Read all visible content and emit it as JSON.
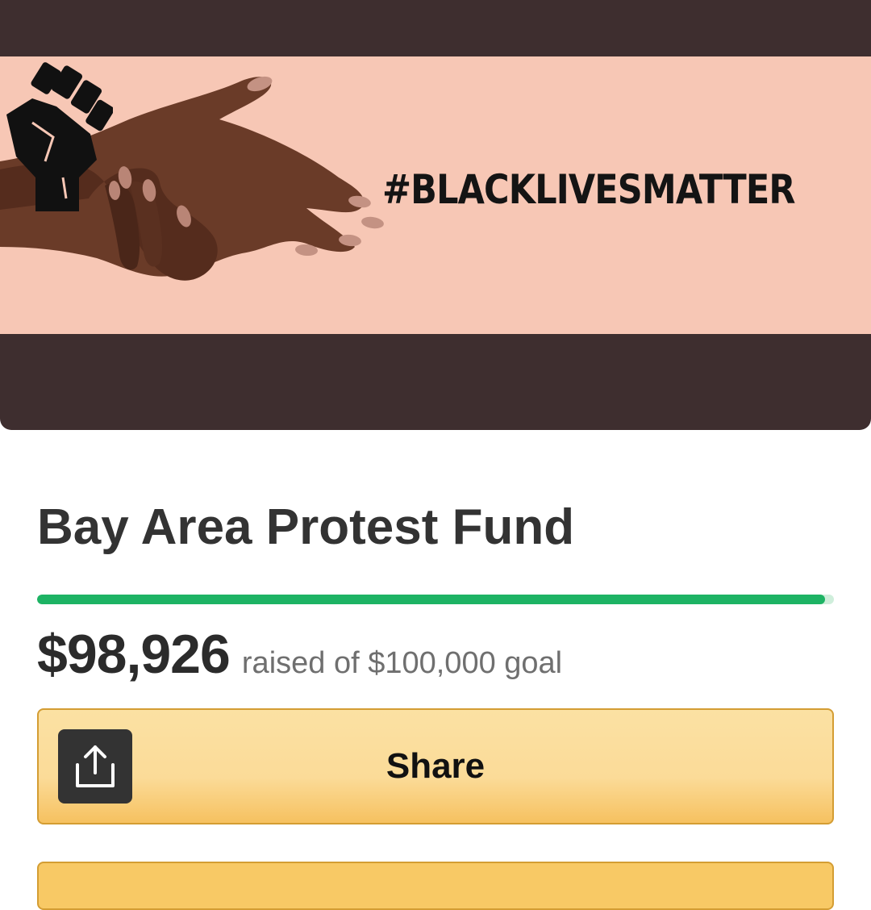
{
  "banner": {
    "hashtag": "#BLACKLIVESMATTER",
    "illustration": "clasped-hands-illustration",
    "fist_icon": "raised-fist-icon",
    "colors": {
      "frame": "#3e2e2f",
      "background": "#f7c7b5"
    }
  },
  "fundraiser": {
    "title": "Bay Area Protest Fund",
    "raised": "$98,926",
    "goal_text": "raised of $100,000 goal",
    "progress_fraction": 0.98926,
    "progress_color": "#1db364"
  },
  "actions": {
    "share_label": "Share",
    "share_icon": "share-upload-icon",
    "button_color": "#fbdb98"
  }
}
